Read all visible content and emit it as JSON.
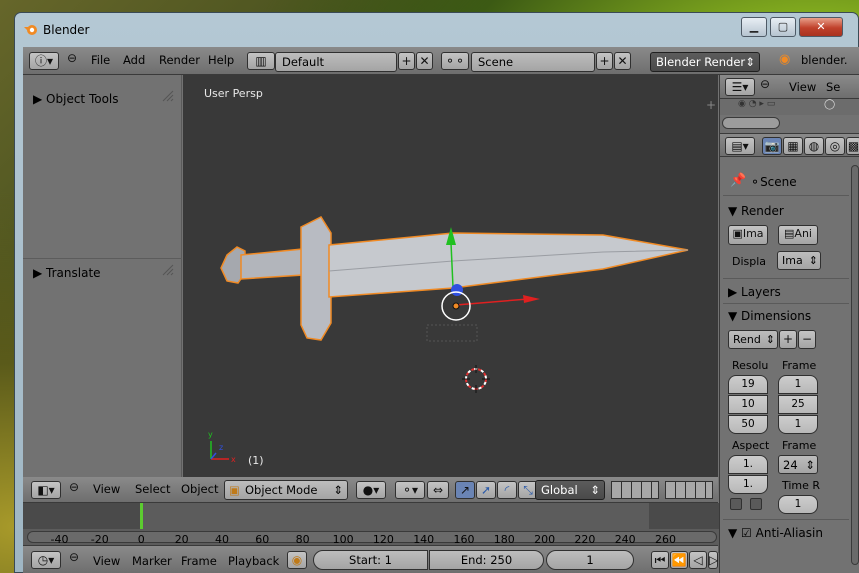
{
  "window": {
    "title": "Blender",
    "minimize_glyph": "▁",
    "maximize_glyph": "▢",
    "close_glyph": "✕"
  },
  "top_header": {
    "menus": [
      "File",
      "Add",
      "Render",
      "Help"
    ],
    "layout": "Default",
    "scene": "Scene",
    "engine": "Blender Render",
    "stats_label": "blender."
  },
  "tool_shelf": {
    "object_tools": "Object Tools",
    "translate": "Translate"
  },
  "viewport": {
    "label": "User Persp",
    "frame_indicator": "(1)",
    "axis_x": "x",
    "axis_y": "y",
    "axis_z": "z"
  },
  "view3d_header": {
    "menus": [
      "View",
      "Select",
      "Object"
    ],
    "mode": "Object Mode",
    "orientation": "Global"
  },
  "outliner": {
    "view_label": "View",
    "search_label": "Se"
  },
  "properties": {
    "scene_label": "Scene",
    "render_section": "Render",
    "image_button": "Ima",
    "anim_button": "Ani",
    "display_label": "Displa",
    "display_value": "Ima",
    "layers_section": "Layers",
    "dimensions_section": "Dimensions",
    "preset": "Rend",
    "resolution_label": "Resolu",
    "frame_range_label": "Frame",
    "res_x": "19",
    "res_y": "10",
    "res_pct": "50",
    "frame_start": "1",
    "frame_end": "25",
    "frame_step": "1",
    "aspect_label": "Aspect",
    "aspect_x": "1.",
    "aspect_y": "1.",
    "frame_rate_label": "Frame",
    "frame_rate": "24",
    "time_remap_label": "Time R",
    "time_remap_value": "1",
    "antialiasing_section": "Anti-Aliasin"
  },
  "timeline": {
    "ticks": [
      "-40",
      "-20",
      "0",
      "20",
      "40",
      "60",
      "80",
      "100",
      "120",
      "140",
      "160",
      "180",
      "200",
      "220",
      "240",
      "260"
    ],
    "current_frame_marker": "0"
  },
  "timeline_header": {
    "menus": [
      "View",
      "Marker",
      "Frame",
      "Playback"
    ],
    "start": "Start: 1",
    "end": "End: 250",
    "current": "1"
  },
  "colors": {
    "accent_orange": "#f08a24",
    "x_axis": "#e02020",
    "y_axis": "#20c020",
    "z_axis": "#3050e0",
    "viewport_bg": "#393939"
  }
}
